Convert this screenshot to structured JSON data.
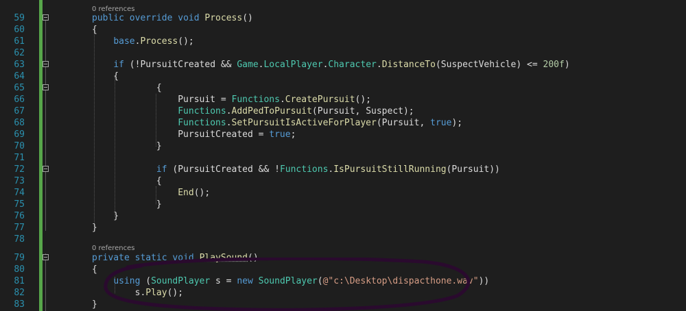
{
  "codelens": [
    {
      "line": 59,
      "text": "0 references"
    },
    {
      "line": 79,
      "text": "0 references"
    }
  ],
  "lines": [
    {
      "n": "59",
      "tokens": [
        [
          "kw",
          "public "
        ],
        [
          "kw",
          "override "
        ],
        [
          "kw",
          "void "
        ],
        [
          "fn",
          "Process"
        ],
        [
          "id",
          "()"
        ]
      ]
    },
    {
      "n": "60",
      "tokens": [
        [
          "id",
          "{"
        ]
      ]
    },
    {
      "n": "61",
      "tokens": [
        [
          "id",
          "    "
        ],
        [
          "kw",
          "base"
        ],
        [
          "id",
          "."
        ],
        [
          "fn",
          "Process"
        ],
        [
          "id",
          "();"
        ]
      ]
    },
    {
      "n": "62",
      "tokens": []
    },
    {
      "n": "63",
      "tokens": [
        [
          "id",
          "    "
        ],
        [
          "kw",
          "if "
        ],
        [
          "id",
          "(!PursuitCreated && "
        ],
        [
          "ty",
          "Game"
        ],
        [
          "id",
          "."
        ],
        [
          "ty",
          "LocalPlayer"
        ],
        [
          "id",
          "."
        ],
        [
          "ty",
          "Character"
        ],
        [
          "id",
          "."
        ],
        [
          "fn",
          "DistanceTo"
        ],
        [
          "id",
          "(SuspectVehicle) <= "
        ],
        [
          "num",
          "200f"
        ],
        [
          "id",
          ")"
        ]
      ]
    },
    {
      "n": "64",
      "tokens": [
        [
          "id",
          "    {"
        ]
      ]
    },
    {
      "n": "65",
      "tokens": [
        [
          "id",
          "            {"
        ]
      ]
    },
    {
      "n": "66",
      "tokens": [
        [
          "id",
          "                Pursuit = "
        ],
        [
          "ty",
          "Functions"
        ],
        [
          "id",
          "."
        ],
        [
          "fn",
          "CreatePursuit"
        ],
        [
          "id",
          "();"
        ]
      ]
    },
    {
      "n": "67",
      "tokens": [
        [
          "id",
          "                "
        ],
        [
          "ty",
          "Functions"
        ],
        [
          "id",
          "."
        ],
        [
          "fn",
          "AddPedToPursuit"
        ],
        [
          "id",
          "(Pursuit, Suspect);"
        ]
      ]
    },
    {
      "n": "68",
      "tokens": [
        [
          "id",
          "                "
        ],
        [
          "ty",
          "Functions"
        ],
        [
          "id",
          "."
        ],
        [
          "fn",
          "SetPursuitIsActiveForPlayer"
        ],
        [
          "id",
          "(Pursuit, "
        ],
        [
          "kw",
          "true"
        ],
        [
          "id",
          ");"
        ]
      ]
    },
    {
      "n": "69",
      "tokens": [
        [
          "id",
          "                PursuitCreated = "
        ],
        [
          "kw",
          "true"
        ],
        [
          "id",
          ";"
        ]
      ]
    },
    {
      "n": "70",
      "tokens": [
        [
          "id",
          "            }"
        ]
      ]
    },
    {
      "n": "71",
      "tokens": []
    },
    {
      "n": "72",
      "tokens": [
        [
          "id",
          "            "
        ],
        [
          "kw",
          "if "
        ],
        [
          "id",
          "(PursuitCreated && !"
        ],
        [
          "ty",
          "Functions"
        ],
        [
          "id",
          "."
        ],
        [
          "fn",
          "IsPursuitStillRunning"
        ],
        [
          "id",
          "(Pursuit))"
        ]
      ]
    },
    {
      "n": "73",
      "tokens": [
        [
          "id",
          "            {"
        ]
      ]
    },
    {
      "n": "74",
      "tokens": [
        [
          "id",
          "                "
        ],
        [
          "fn",
          "End"
        ],
        [
          "id",
          "();"
        ]
      ]
    },
    {
      "n": "75",
      "tokens": [
        [
          "id",
          "            }"
        ]
      ]
    },
    {
      "n": "76",
      "tokens": [
        [
          "id",
          "    }"
        ]
      ]
    },
    {
      "n": "77",
      "tokens": [
        [
          "id",
          "}"
        ]
      ]
    },
    {
      "n": "78",
      "tokens": []
    },
    {
      "n": "79",
      "tokens": [
        [
          "kw",
          "private "
        ],
        [
          "kw",
          "static "
        ],
        [
          "kw",
          "void "
        ],
        [
          "fn",
          "PlaySound"
        ],
        [
          "id",
          "()"
        ]
      ]
    },
    {
      "n": "80",
      "tokens": [
        [
          "id",
          "{"
        ]
      ]
    },
    {
      "n": "81",
      "tokens": [
        [
          "id",
          "    "
        ],
        [
          "kw",
          "using "
        ],
        [
          "id",
          "("
        ],
        [
          "ty",
          "SoundPlayer"
        ],
        [
          "id",
          " s = "
        ],
        [
          "kw",
          "new "
        ],
        [
          "ty",
          "SoundPlayer"
        ],
        [
          "id",
          "("
        ],
        [
          "str",
          "@\"c:\\Desktop\\dispacthone.wav\""
        ],
        [
          "id",
          "))"
        ]
      ]
    },
    {
      "n": "82",
      "tokens": [
        [
          "id",
          "        s."
        ],
        [
          "fn",
          "Play"
        ],
        [
          "id",
          "();"
        ]
      ]
    },
    {
      "n": "83",
      "tokens": [
        [
          "id",
          "}"
        ]
      ]
    }
  ],
  "colors": {
    "background": "#1e1e1e",
    "line_number": "#2b91af",
    "change_bar": "#57a64a",
    "keyword": "#569cd6",
    "type": "#4ec9b0",
    "method": "#dcdcaa",
    "string": "#d69d85",
    "number": "#b5cea8",
    "ink_circle": "#2a0a2e"
  }
}
